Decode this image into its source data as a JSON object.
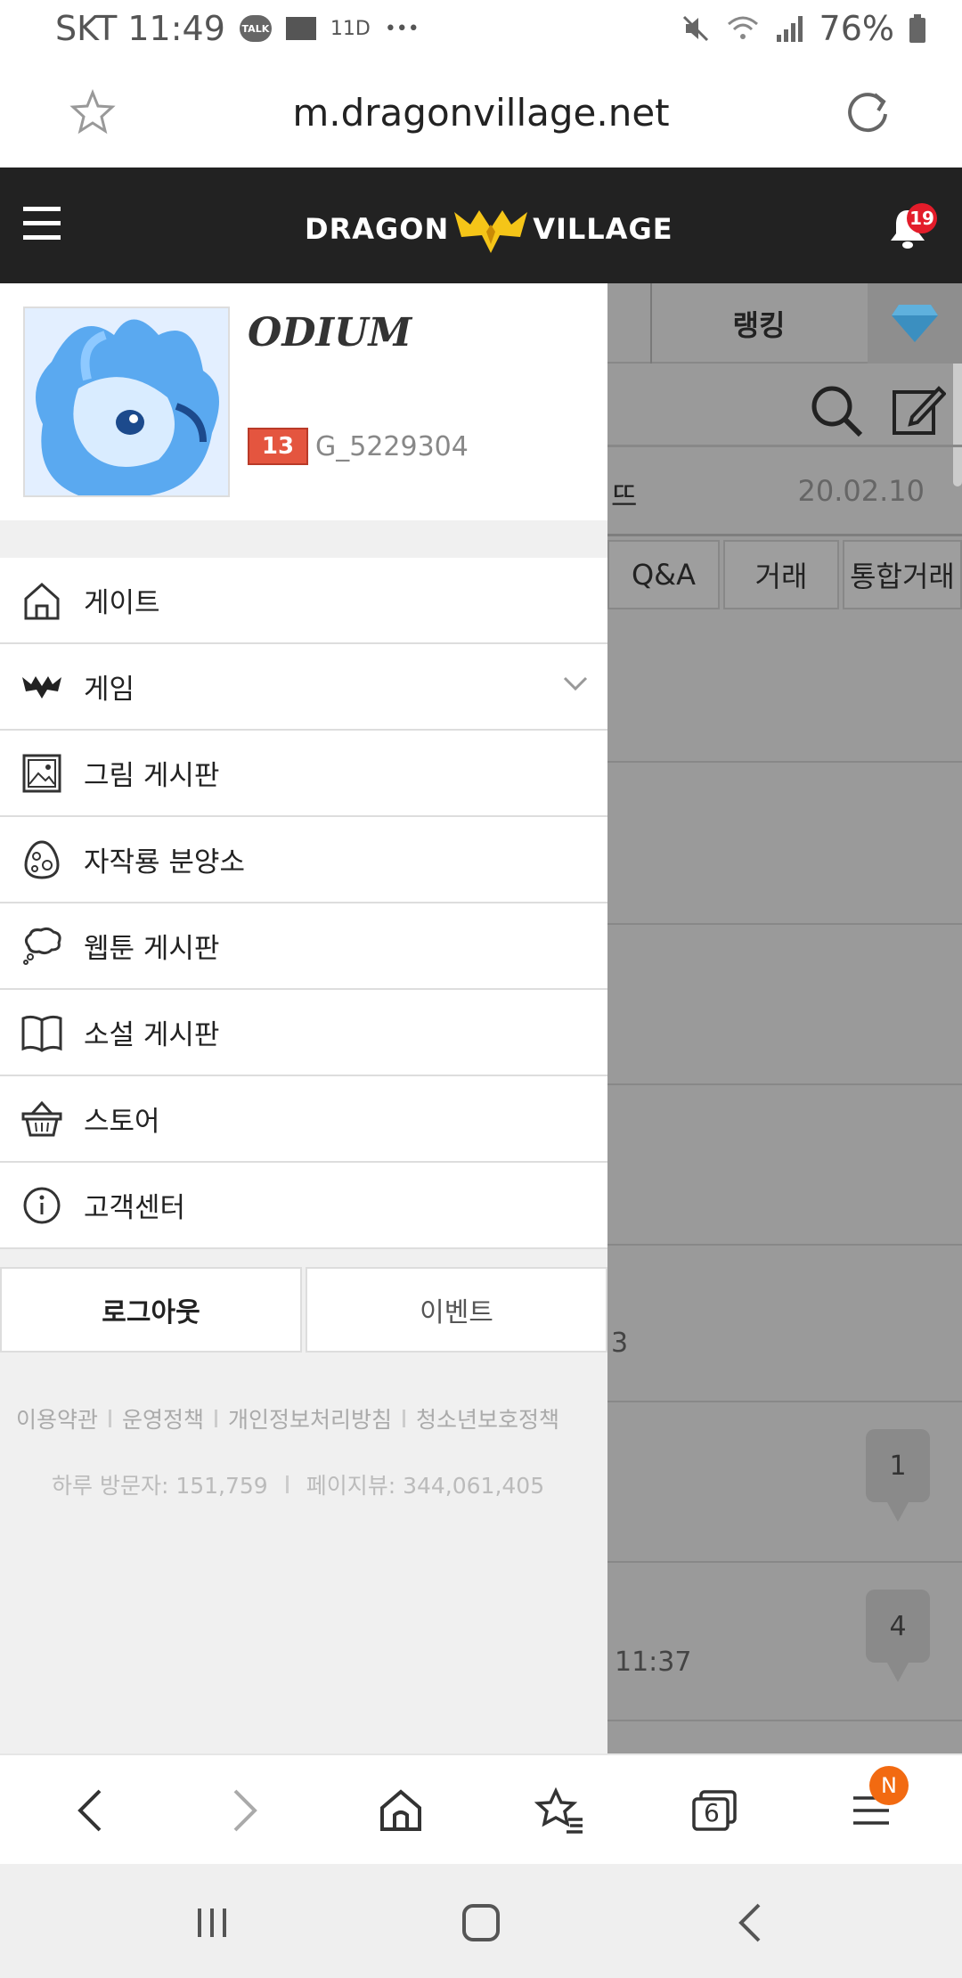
{
  "status_bar": {
    "carrier_time": "SKT 11:49",
    "talk_label": "TALK",
    "extra_icon_text": "11D",
    "dots": "•••",
    "battery": "76%"
  },
  "url_bar": {
    "url": "m.dragonvillage.net"
  },
  "app_header": {
    "logo_left": "DRAGON",
    "logo_right": "VILLAGE",
    "notification_count": "19"
  },
  "profile": {
    "username": "ODIUM",
    "level": "13",
    "user_id": "G_5229304"
  },
  "menu": [
    {
      "label": "게이트",
      "icon": "home-icon"
    },
    {
      "label": "게임",
      "icon": "dragon-icon"
    },
    {
      "label": "그림 게시판",
      "icon": "picture-icon"
    },
    {
      "label": "자작룡 분양소",
      "icon": "egg-icon"
    },
    {
      "label": "웹툰 게시판",
      "icon": "thought-cloud-icon"
    },
    {
      "label": "소설 게시판",
      "icon": "book-icon"
    },
    {
      "label": "스토어",
      "icon": "basket-icon"
    },
    {
      "label": "고객센터",
      "icon": "info-icon"
    }
  ],
  "auth": {
    "logout": "로그아웃",
    "event": "이벤트"
  },
  "footer": {
    "links": [
      "이용약관",
      "운영정책",
      "개인정보처리방침",
      "청소년보호정책"
    ],
    "daily_visitors": "하루 방문자: 151,759",
    "page_views": "페이지뷰: 344,061,405"
  },
  "background_page": {
    "tab_ranking": "랭킹",
    "row_prefix": "뜨",
    "row_date": "20.02.10",
    "categories": [
      "Q&A",
      "거래",
      "통합거래"
    ],
    "partial_text_1": "3",
    "partial_time": "11:37",
    "comment_counts": [
      "1",
      "4"
    ]
  },
  "browser_bar": {
    "tabs_count": "6",
    "menu_badge": "N"
  },
  "colors": {
    "header_bg": "#222222",
    "logo_accent": "#f5c518",
    "badge_red": "#e31c2a",
    "level_badge": "#e4553f",
    "menu_badge_orange": "#f26a11"
  }
}
